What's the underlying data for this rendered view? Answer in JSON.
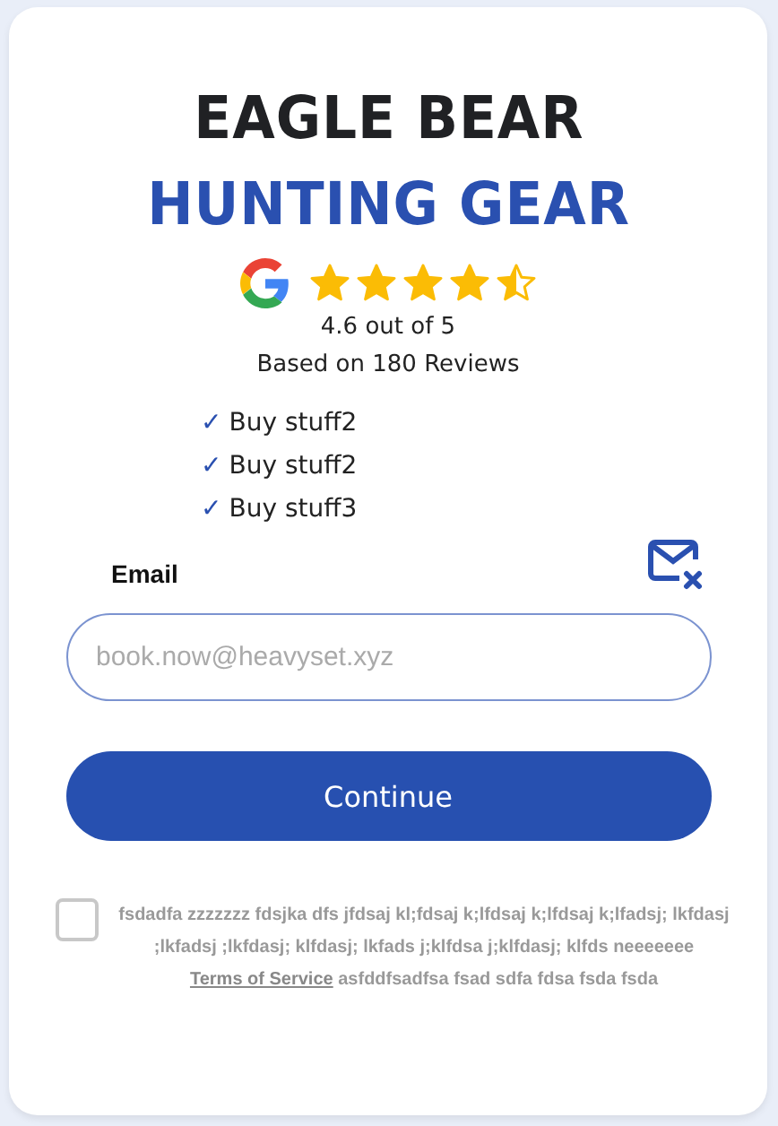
{
  "brand": {
    "line_1": "EAGLE BEAR",
    "line_2": "HUNTING GEAR"
  },
  "rating": {
    "stars": 4.5,
    "score": "4.6 out of 5",
    "reviews": "Based on 180 Reviews"
  },
  "benefits": [
    {
      "mark": "✓",
      "text": "Buy stuff2"
    },
    {
      "mark": "✓",
      "text": "Buy stuff2"
    },
    {
      "mark": "✓",
      "text": "Buy stuff3"
    }
  ],
  "email": {
    "label": "Email",
    "placeholder": "book.now@heavyset.xyz"
  },
  "continue_button": "Continue",
  "consent": {
    "checked": false,
    "text_before": "fsdadfa zzzzzzz fdsjka dfs jfdsaj kl;fdsaj k;lfdsaj k;lfdsaj k;lfadsj; lkfdasj ;lkfadsj ;lkfdasj; klfdasj; lkfads j;klfdsa j;klfdasj; klfds neeeeeee",
    "link": "Terms of Service",
    "text_after": "asfddfsadfsa fsad sdfa fdsa fsda fsda"
  }
}
